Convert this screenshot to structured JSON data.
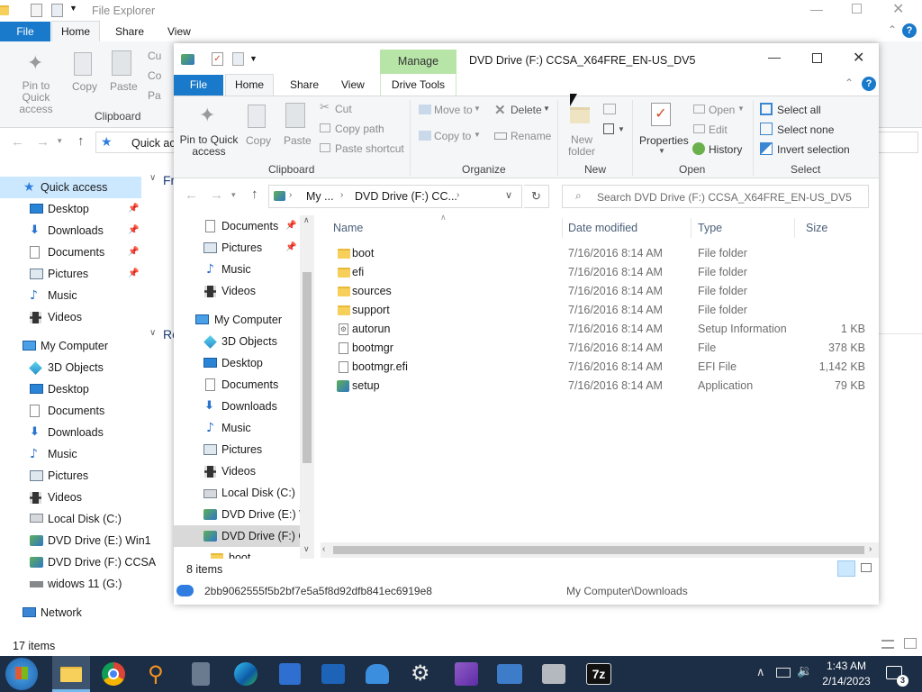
{
  "back_window": {
    "title": "File Explorer",
    "tabs": [
      "File",
      "Home",
      "Share",
      "View"
    ],
    "ribbon": {
      "pin_label": "Pin to Quick access",
      "copy_label": "Copy",
      "paste_label": "Paste",
      "cut_partial": "Cu",
      "copy_partial": "Co",
      "paste_partial": "Pa",
      "clipboard_group": "Clipboard"
    },
    "address_text": "Quick ac",
    "section_frequent": "Fr",
    "section_recent": "Re",
    "nav": [
      {
        "label": "Quick access",
        "icon": "star-icon"
      },
      {
        "label": "Desktop",
        "icon": "desktop-icon",
        "pinned": true
      },
      {
        "label": "Downloads",
        "icon": "downloads-icon",
        "pinned": true
      },
      {
        "label": "Documents",
        "icon": "documents-icon",
        "pinned": true
      },
      {
        "label": "Pictures",
        "icon": "pictures-icon",
        "pinned": true
      },
      {
        "label": "Music",
        "icon": "music-icon"
      },
      {
        "label": "Videos",
        "icon": "videos-icon"
      },
      {
        "label": "My Computer",
        "icon": "computer-icon"
      },
      {
        "label": "3D Objects",
        "icon": "3d-objects-icon"
      },
      {
        "label": "Desktop",
        "icon": "desktop-icon"
      },
      {
        "label": "Documents",
        "icon": "documents-icon"
      },
      {
        "label": "Downloads",
        "icon": "downloads-icon"
      },
      {
        "label": "Music",
        "icon": "music-icon"
      },
      {
        "label": "Pictures",
        "icon": "pictures-icon"
      },
      {
        "label": "Videos",
        "icon": "videos-icon"
      },
      {
        "label": "Local Disk (C:)",
        "icon": "local-disk-icon"
      },
      {
        "label": "DVD Drive (E:) Win1",
        "icon": "dvd-drive-icon"
      },
      {
        "label": "DVD Drive (F:) CCSA",
        "icon": "dvd-drive-icon"
      },
      {
        "label": "widows 11 (G:)",
        "icon": "usb-drive-icon"
      },
      {
        "label": "Network",
        "icon": "network-icon"
      }
    ],
    "status": "17 items"
  },
  "front_window": {
    "title": "DVD Drive (F:) CCSA_X64FRE_EN-US_DV5",
    "context_tab_header": "Manage",
    "tabs": [
      "File",
      "Home",
      "Share",
      "View",
      "Drive Tools"
    ],
    "ribbon": {
      "pin_label": "Pin to Quick access",
      "copy_label": "Copy",
      "paste_label": "Paste",
      "cut_label": "Cut",
      "copy_path_label": "Copy path",
      "paste_shortcut_label": "Paste shortcut",
      "clipboard_group": "Clipboard",
      "move_to_label": "Move to",
      "copy_to_label": "Copy to",
      "delete_label": "Delete",
      "rename_label": "Rename",
      "organize_group": "Organize",
      "new_folder_label": "New folder",
      "new_group": "New",
      "properties_label": "Properties",
      "open_label": "Open",
      "edit_label": "Edit",
      "history_label": "History",
      "open_group": "Open",
      "select_all_label": "Select all",
      "select_none_label": "Select none",
      "invert_selection_label": "Invert selection",
      "select_group": "Select"
    },
    "breadcrumb": [
      "My ...",
      "DVD Drive (F:) CC..."
    ],
    "search_placeholder": "Search DVD Drive (F:) CCSA_X64FRE_EN-US_DV5",
    "nav": [
      {
        "label": "Documents",
        "icon": "documents-icon",
        "pinned": true
      },
      {
        "label": "Pictures",
        "icon": "pictures-icon",
        "pinned": true
      },
      {
        "label": "Music",
        "icon": "music-icon"
      },
      {
        "label": "Videos",
        "icon": "videos-icon"
      },
      {
        "label": "My Computer",
        "icon": "computer-icon"
      },
      {
        "label": "3D Objects",
        "icon": "3d-objects-icon"
      },
      {
        "label": "Desktop",
        "icon": "desktop-icon"
      },
      {
        "label": "Documents",
        "icon": "documents-icon"
      },
      {
        "label": "Downloads",
        "icon": "downloads-icon"
      },
      {
        "label": "Music",
        "icon": "music-icon"
      },
      {
        "label": "Pictures",
        "icon": "pictures-icon"
      },
      {
        "label": "Videos",
        "icon": "videos-icon"
      },
      {
        "label": "Local Disk (C:)",
        "icon": "local-disk-icon"
      },
      {
        "label": "DVD Drive (E:) W",
        "icon": "dvd-drive-icon"
      },
      {
        "label": "DVD Drive (F:) C(",
        "icon": "dvd-drive-icon",
        "selected": true
      },
      {
        "label": "boot",
        "icon": "folder-icon"
      }
    ],
    "columns": [
      "Name",
      "Date modified",
      "Type",
      "Size"
    ],
    "files": [
      {
        "name": "boot",
        "date": "7/16/2016 8:14 AM",
        "type": "File folder",
        "size": "",
        "icon": "folder-icon"
      },
      {
        "name": "efi",
        "date": "7/16/2016 8:14 AM",
        "type": "File folder",
        "size": "",
        "icon": "folder-icon"
      },
      {
        "name": "sources",
        "date": "7/16/2016 8:14 AM",
        "type": "File folder",
        "size": "",
        "icon": "folder-icon"
      },
      {
        "name": "support",
        "date": "7/16/2016 8:14 AM",
        "type": "File folder",
        "size": "",
        "icon": "folder-icon"
      },
      {
        "name": "autorun",
        "date": "7/16/2016 8:14 AM",
        "type": "Setup Information",
        "size": "1 KB",
        "icon": "setup-info-icon"
      },
      {
        "name": "bootmgr",
        "date": "7/16/2016 8:14 AM",
        "type": "File",
        "size": "378 KB",
        "icon": "file-icon"
      },
      {
        "name": "bootmgr.efi",
        "date": "7/16/2016 8:14 AM",
        "type": "EFI File",
        "size": "1,142 KB",
        "icon": "file-icon"
      },
      {
        "name": "setup",
        "date": "7/16/2016 8:14 AM",
        "type": "Application",
        "size": "79 KB",
        "icon": "setup-app-icon"
      }
    ],
    "status": "8 items"
  },
  "notification": {
    "text": "2bb9062555f5b2bf7e5a5f8d92dfb841ec6919e8",
    "path": "My Computer\\Downloads"
  },
  "taskbar": {
    "time": "1:43 AM",
    "date": "2/14/2023",
    "notification_count": "3",
    "app_7z_label": "7z"
  },
  "colors": {
    "accent": "#1979ca",
    "selection": "#cce8ff",
    "manage_tab": "#b7e4a7",
    "taskbar": "#1c2e45"
  }
}
